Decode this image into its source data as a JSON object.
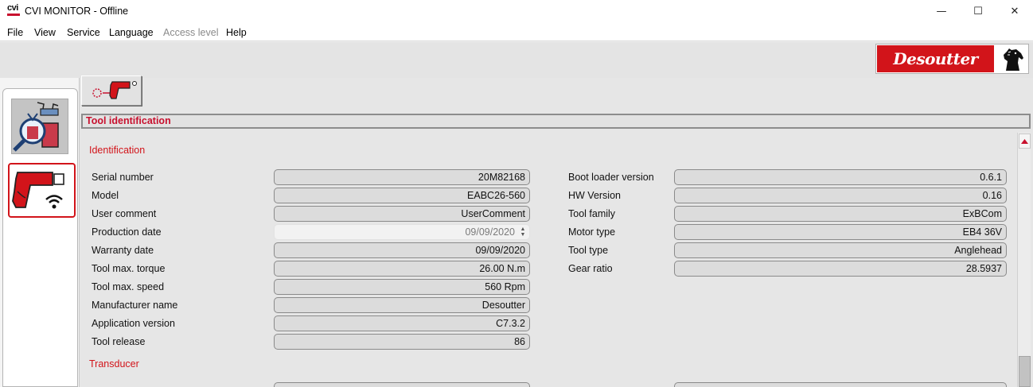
{
  "window": {
    "app_logo_text": "cvi",
    "title": "CVI MONITOR - Offline",
    "controls": {
      "minimize": "—",
      "maximize": "☐",
      "close": "✕"
    }
  },
  "menu": {
    "items": [
      {
        "label": "File",
        "enabled": true
      },
      {
        "label": "View",
        "enabled": true
      },
      {
        "label": "Service",
        "enabled": true
      },
      {
        "label": "Language",
        "enabled": true
      },
      {
        "label": "Access level",
        "enabled": false
      },
      {
        "label": "Help",
        "enabled": true
      }
    ]
  },
  "brand": {
    "name": "Desoutter",
    "icon": "horse-head-icon",
    "color": "#d2141a"
  },
  "sidebar": {
    "items": [
      {
        "icon": "tool-diagnostics-icon",
        "selected": false
      },
      {
        "icon": "tool-wireless-icon",
        "selected": true
      }
    ]
  },
  "toolbar": {
    "icon": "tool-connection-icon"
  },
  "section": {
    "title": "Tool identification"
  },
  "identification": {
    "title": "Identification",
    "left": [
      {
        "label": "Serial number",
        "value": "20M82168"
      },
      {
        "label": "Model",
        "value": "EABC26-560"
      },
      {
        "label": "User comment",
        "value": "UserComment"
      },
      {
        "label": "Production date",
        "value": "09/09/2020"
      },
      {
        "label": "Warranty date",
        "value": "09/09/2020"
      },
      {
        "label": "Tool max. torque",
        "value": "26.00 N.m"
      },
      {
        "label": "Tool max. speed",
        "value": "560 Rpm"
      },
      {
        "label": "Manufacturer name",
        "value": "Desoutter"
      },
      {
        "label": "Application version",
        "value": "C7.3.2"
      },
      {
        "label": "Tool release",
        "value": "86"
      }
    ],
    "right": [
      {
        "label": "Boot loader version",
        "value": "0.6.1"
      },
      {
        "label": "HW Version",
        "value": "0.16"
      },
      {
        "label": "Tool family",
        "value": "ExBCom"
      },
      {
        "label": "Motor type",
        "value": "EB4 36V"
      },
      {
        "label": "Tool type",
        "value": "Anglehead"
      },
      {
        "label": "Gear ratio",
        "value": "28.5937"
      }
    ]
  },
  "transducer": {
    "title": "Transducer"
  },
  "colors": {
    "accent": "#d2141a",
    "panel": "#e6e6e6"
  }
}
